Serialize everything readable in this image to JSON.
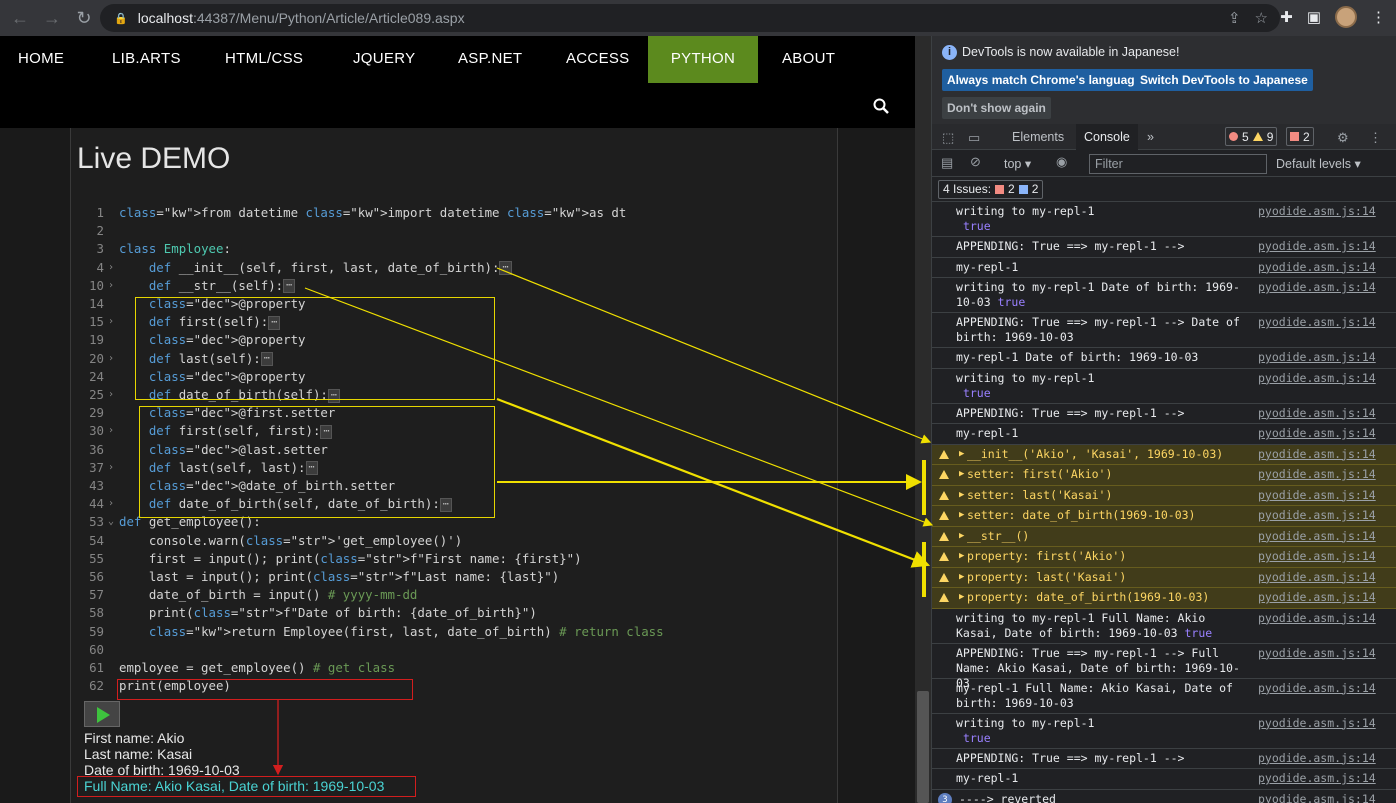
{
  "browser": {
    "url_host": "localhost",
    "url_rest": ":44387/Menu/Python/Article/Article089.aspx"
  },
  "nav": {
    "items": [
      "HOME",
      "LIB.ARTS",
      "HTML/CSS",
      "JQUERY",
      "ASP.NET",
      "ACCESS",
      "PYTHON",
      "ABOUT"
    ],
    "active": "PYTHON"
  },
  "page": {
    "title": "Live DEMO"
  },
  "code_lines": [
    {
      "n": "1",
      "t": "from datetime import datetime as dt"
    },
    {
      "n": "2",
      "t": ""
    },
    {
      "n": "3",
      "t": "class Employee:"
    },
    {
      "n": "4",
      "t": "    def __init__(self, first, last, date_of_birth):"
    },
    {
      "n": "10",
      "t": "    def __str__(self):"
    },
    {
      "n": "14",
      "t": "    @property"
    },
    {
      "n": "15",
      "t": "    def first(self):"
    },
    {
      "n": "19",
      "t": "    @property"
    },
    {
      "n": "20",
      "t": "    def last(self):"
    },
    {
      "n": "24",
      "t": "    @property"
    },
    {
      "n": "25",
      "t": "    def date_of_birth(self):"
    },
    {
      "n": "29",
      "t": "    @first.setter"
    },
    {
      "n": "30",
      "t": "    def first(self, first):"
    },
    {
      "n": "36",
      "t": "    @last.setter"
    },
    {
      "n": "37",
      "t": "    def last(self, last):"
    },
    {
      "n": "43",
      "t": "    @date_of_birth.setter"
    },
    {
      "n": "44",
      "t": "    def date_of_birth(self, date_of_birth):"
    },
    {
      "n": "53",
      "t": "def get_employee():"
    },
    {
      "n": "54",
      "t": "    console.warn('get_employee()')"
    },
    {
      "n": "55",
      "t": "    first = input(); print(f\"First name: {first}\")"
    },
    {
      "n": "56",
      "t": "    last = input(); print(f\"Last name: {last}\")"
    },
    {
      "n": "57",
      "t": "    date_of_birth = input() # yyyy-mm-dd"
    },
    {
      "n": "58",
      "t": "    print(f\"Date of birth: {date_of_birth}\")"
    },
    {
      "n": "59",
      "t": "    return Employee(first, last, date_of_birth) # return class"
    },
    {
      "n": "60",
      "t": ""
    },
    {
      "n": "61",
      "t": "employee = get_employee() # get class"
    },
    {
      "n": "62",
      "t": "print(employee)"
    }
  ],
  "ellipsis": "⋯",
  "output": {
    "first": "First name: Akio",
    "last": "Last name: Kasai",
    "dob": "Date of birth: 1969-10-03",
    "full": "Full Name: Akio Kasai, Date of birth: 1969-10-03"
  },
  "devtools": {
    "banner": "DevTools is now available in Japanese!",
    "btn_match": "Always match Chrome's language",
    "btn_switch": "Switch DevTools to Japanese",
    "btn_dont": "Don't show again",
    "tab_elements": "Elements",
    "tab_console": "Console",
    "tab_more": "»",
    "err_count": "5",
    "warn_count": "9",
    "issue_count": "2",
    "context": "top ▾",
    "filter_placeholder": "Filter",
    "levels": "Default levels ▾",
    "issues_label": "4 Issues:",
    "issues_red": "2",
    "issues_blue": "2"
  },
  "console": [
    {
      "type": "log",
      "text": "writing to my-repl-1",
      "extra": "true",
      "src": "pyodide.asm.js:14"
    },
    {
      "type": "log",
      "text": "APPENDING: True ==> my-repl-1 -->",
      "src": "pyodide.asm.js:14"
    },
    {
      "type": "log",
      "text": "my-repl-1",
      "src": "pyodide.asm.js:14"
    },
    {
      "type": "log",
      "text": "writing to my-repl-1 Date of birth: 1969-10-03",
      "extra": "true",
      "src": "pyodide.asm.js:14"
    },
    {
      "type": "log",
      "text": "APPENDING: True ==> my-repl-1 --> Date of birth: 1969-10-03",
      "src": "pyodide.asm.js:14"
    },
    {
      "type": "log",
      "text": "my-repl-1 Date of birth: 1969-10-03",
      "src": "pyodide.asm.js:14"
    },
    {
      "type": "log",
      "text": "writing to my-repl-1",
      "extra": "true",
      "src": "pyodide.asm.js:14"
    },
    {
      "type": "log",
      "text": "APPENDING: True ==> my-repl-1 -->",
      "src": "pyodide.asm.js:14"
    },
    {
      "type": "log",
      "text": "my-repl-1",
      "src": "pyodide.asm.js:14"
    },
    {
      "type": "warn",
      "text": "__init__('Akio', 'Kasai', 1969-10-03)",
      "src": "pyodide.asm.js:14"
    },
    {
      "type": "warn",
      "text": "setter: first('Akio')",
      "src": "pyodide.asm.js:14"
    },
    {
      "type": "warn",
      "text": "setter: last('Kasai')",
      "src": "pyodide.asm.js:14"
    },
    {
      "type": "warn",
      "text": "setter: date_of_birth(1969-10-03)",
      "src": "pyodide.asm.js:14"
    },
    {
      "type": "warn",
      "text": "__str__()",
      "src": "pyodide.asm.js:14"
    },
    {
      "type": "warn",
      "text": "property: first('Akio')",
      "src": "pyodide.asm.js:14"
    },
    {
      "type": "warn",
      "text": "property: last('Kasai')",
      "src": "pyodide.asm.js:14"
    },
    {
      "type": "warn",
      "text": "property: date_of_birth(1969-10-03)",
      "src": "pyodide.asm.js:14"
    },
    {
      "type": "log",
      "text": "writing to my-repl-1 Full Name: Akio Kasai, Date of birth: 1969-10-03",
      "extra": "true",
      "src": "pyodide.asm.js:14"
    },
    {
      "type": "log",
      "text": "APPENDING: True ==> my-repl-1 --> Full Name: Akio Kasai, Date of birth: 1969-10-03",
      "src": "pyodide.asm.js:14"
    },
    {
      "type": "log",
      "text": "my-repl-1 Full Name: Akio Kasai, Date of birth: 1969-10-03",
      "src": "pyodide.asm.js:14"
    },
    {
      "type": "log",
      "text": "writing to my-repl-1",
      "extra": "true",
      "src": "pyodide.asm.js:14"
    },
    {
      "type": "log",
      "text": "APPENDING: True ==> my-repl-1 -->",
      "src": "pyodide.asm.js:14"
    },
    {
      "type": "log",
      "text": "my-repl-1",
      "src": "pyodide.asm.js:14"
    },
    {
      "type": "count",
      "count": "3",
      "text": "----> reverted",
      "src": "pyodide.asm.js:14"
    }
  ]
}
